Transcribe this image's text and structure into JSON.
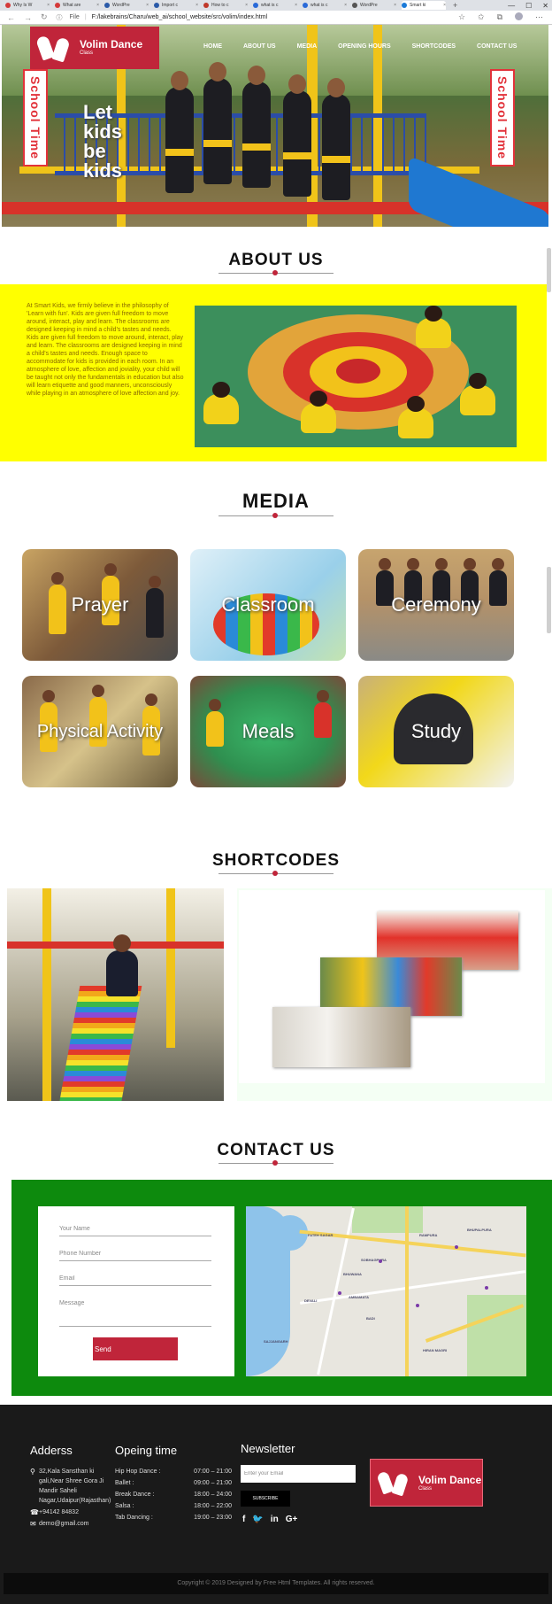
{
  "browser": {
    "tabs": [
      {
        "title": "Why Is W",
        "fav": "#d43a3a"
      },
      {
        "title": "What are",
        "fav": "#d43a3a"
      },
      {
        "title": "WordPre",
        "fav": "#2a5aa8"
      },
      {
        "title": "Import c",
        "fav": "#2a5aa8"
      },
      {
        "title": "How to c",
        "fav": "#c0392b"
      },
      {
        "title": "what is c",
        "fav": "#2a6ad8"
      },
      {
        "title": "what is c",
        "fav": "#2a6ad8"
      },
      {
        "title": "WordPre",
        "fav": "#555555"
      },
      {
        "title": "Smart ki",
        "fav": "#1b7ad8"
      }
    ],
    "file_label": "File",
    "url": "F:/lakebrains/Charu/web_ai/school_website/src/volim/index.html",
    "new_tab": "+",
    "window_controls": [
      "—",
      "☐",
      "✕"
    ]
  },
  "header": {
    "logo_name": "Volim Dance",
    "logo_sub": "Class",
    "menu": [
      "HOME",
      "ABOUT US",
      "MEDIA",
      "OPENING HOURS",
      "SHORTCODES",
      "CONTACT US"
    ]
  },
  "hero": {
    "banner_left": "School Time",
    "banner_right": "School Time",
    "headline": [
      "Let",
      "kids",
      "be",
      "kids"
    ],
    "slides": 3,
    "active_slide": 0
  },
  "about": {
    "title": "ABOUT US",
    "text": "At Smart Kids, we firmly believe in the philosophy of 'Learn with fun'. Kids are given full freedom to move around, interact, play and learn. The classrooms are designed keeping in mind a child's tastes and needs. Kids are given full freedom to move around, interact, play and learn. The classrooms are designed keeping in mind a child's tastes and needs. Enough space to accommodate for kids is provided in each room. In an atmosphere of love, affection and joviality, your child will be taught not only the fundamentals in education but also will learn etiquette and good manners, unconsciously while playing in an atmosphere of love affection and joy."
  },
  "media": {
    "title": "MEDIA",
    "cards": [
      "Prayer",
      "Classroom",
      "Ceremony",
      "Physical Activity",
      "Meals",
      "Study"
    ]
  },
  "shortcodes": {
    "title": "SHORTCODES"
  },
  "contact": {
    "title": "CONTACT US",
    "name_placeholder": "Your Name",
    "phone_placeholder": "Phone Number",
    "email_placeholder": "Email",
    "message_placeholder": "Message",
    "send_label": "Send",
    "map_labels": [
      "FATEH SAGAR",
      "SOBHAGPURA",
      "BHUWANA",
      "DEVALI",
      "HIRAN MAGRI",
      "BADI",
      "RAMPURA",
      "BHUPALPURA",
      "SAJJANGARH",
      "AMBAMATA"
    ]
  },
  "footer": {
    "address_title": "Adderss",
    "address": "32,Kala Sansthan ki gali,Near Shree Gora Ji Mandir Saheli Nagar,Udaipur(Rajasthan)",
    "phone": "+94142 84832",
    "email": "demo@gmail.com",
    "hours_title": "Opeing time",
    "hours": [
      {
        "name": "Hip Hop Dance :",
        "time": "07:00 – 21:00"
      },
      {
        "name": "Ballet :",
        "time": "09:00 – 21:00"
      },
      {
        "name": "Break Dance :",
        "time": "18:00 – 24:00"
      },
      {
        "name": "Salsa :",
        "time": "18:00 – 22:00"
      },
      {
        "name": "Tab Dancing :",
        "time": "19:00 – 23:00"
      }
    ],
    "newsletter_title": "Newsletter",
    "newsletter_placeholder": "Enter your Email",
    "subscribe_label": "SUBSCRIBE",
    "social": [
      "f",
      "🐦",
      "in",
      "G+"
    ],
    "logo_name": "Volim Dance",
    "logo_sub": "Class",
    "copyright": "Copyright © 2019 Designed by Free Html Templates. All rights reserved."
  },
  "colors": {
    "brand_red": "#c0253a",
    "about_bg": "#ffff00",
    "contact_bg": "#0d8a0d",
    "footer_bg": "#1a1a1a"
  }
}
